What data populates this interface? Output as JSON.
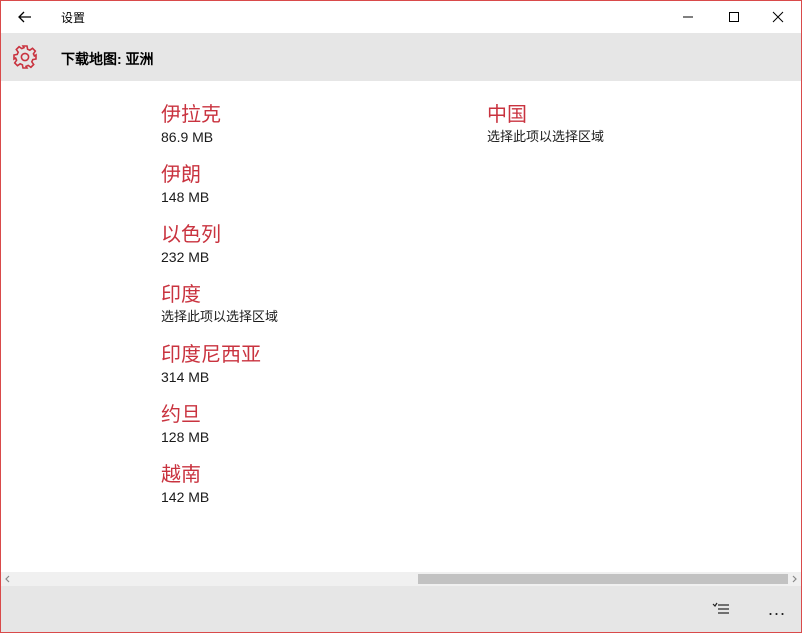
{
  "window": {
    "title": "设置"
  },
  "header": {
    "title": "下载地图: 亚洲"
  },
  "regions_left": [
    {
      "name": "伊拉克",
      "detail": "86.9 MB"
    },
    {
      "name": "伊朗",
      "detail": "148 MB"
    },
    {
      "name": "以色列",
      "detail": "232 MB"
    },
    {
      "name": "印度",
      "detail": "选择此项以选择区域"
    },
    {
      "name": "印度尼西亚",
      "detail": "314 MB"
    },
    {
      "name": "约旦",
      "detail": "128 MB"
    },
    {
      "name": "越南",
      "detail": "142 MB"
    }
  ],
  "regions_right": [
    {
      "name": "中国",
      "detail": "选择此项以选择区域"
    }
  ],
  "appbar": {
    "more_label": "..."
  },
  "colors": {
    "accent": "#c9333f",
    "header_bg": "#e6e6e6",
    "window_border": "#d94a4a"
  },
  "icons": [
    "back-arrow-icon",
    "minimize-icon",
    "maximize-icon",
    "close-icon",
    "gear-icon",
    "list-icon",
    "more-icon"
  ]
}
